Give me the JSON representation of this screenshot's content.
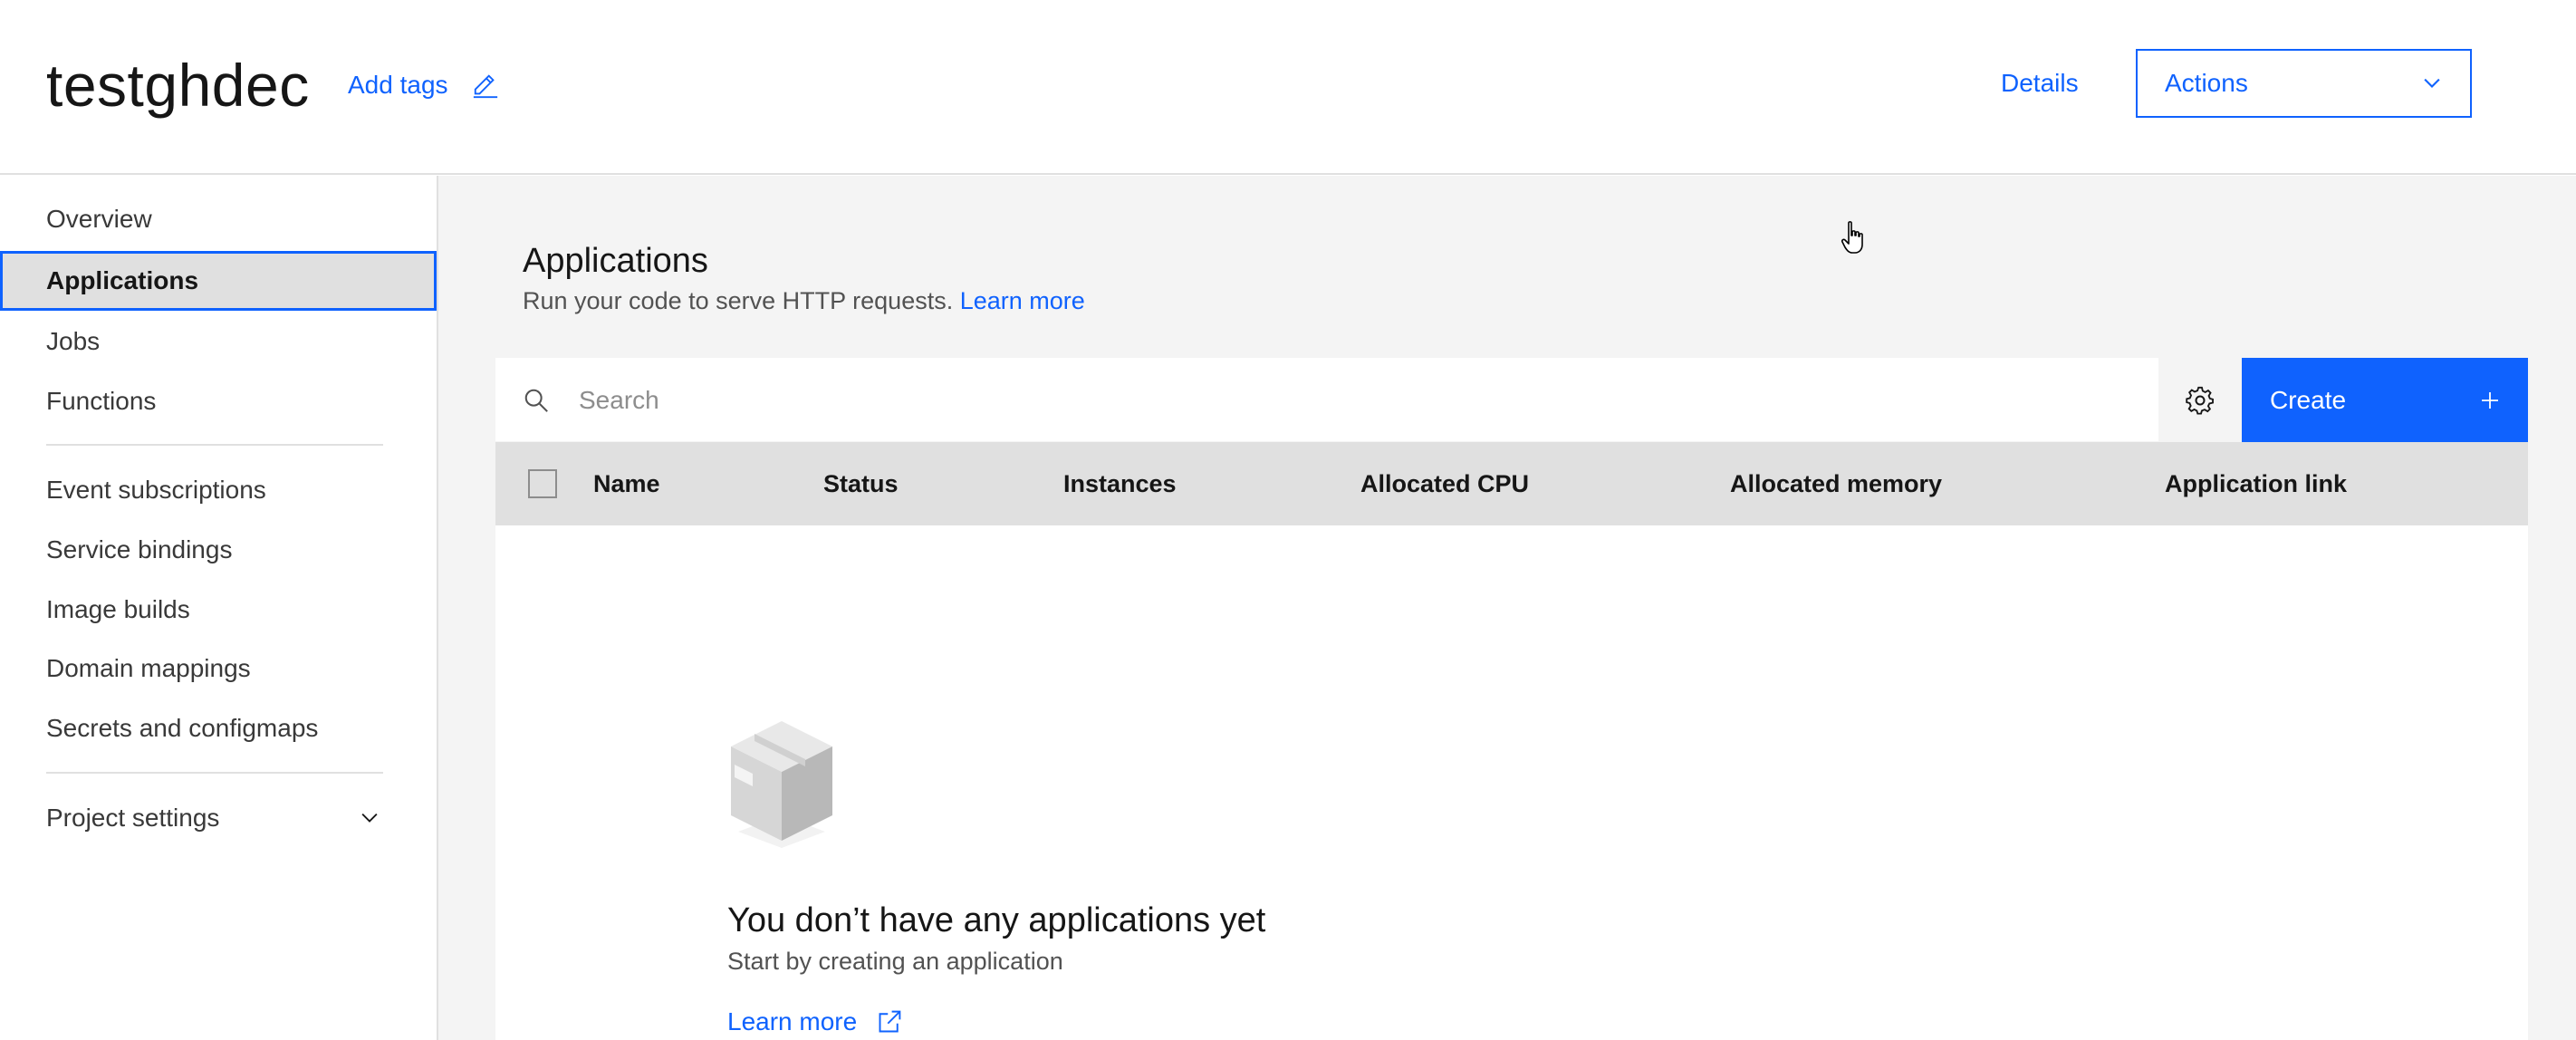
{
  "header": {
    "project_name": "testghdec",
    "add_tags_label": "Add tags",
    "details_label": "Details",
    "actions_label": "Actions"
  },
  "sidebar": {
    "items": [
      {
        "label": "Overview"
      },
      {
        "label": "Applications"
      },
      {
        "label": "Jobs"
      },
      {
        "label": "Functions"
      },
      {
        "label": "Event subscriptions"
      },
      {
        "label": "Service bindings"
      },
      {
        "label": "Image builds"
      },
      {
        "label": "Domain mappings"
      },
      {
        "label": "Secrets and configmaps"
      },
      {
        "label": "Project settings"
      }
    ],
    "active_item": "Applications"
  },
  "main": {
    "title": "Applications",
    "subtitle": "Run your code to serve HTTP requests.",
    "subtitle_link": "Learn more",
    "search": {
      "placeholder": "Search",
      "value": ""
    },
    "create_label": "Create",
    "table": {
      "columns": [
        "Name",
        "Status",
        "Instances",
        "Allocated CPU",
        "Allocated memory",
        "Application link"
      ],
      "rows": []
    },
    "empty_state": {
      "title": "You don’t have any applications yet",
      "subtitle": "Start by creating an application",
      "link_label": "Learn more"
    }
  },
  "icons": {
    "edit": "pencil-icon",
    "dropdown": "chevron-down-icon",
    "search": "search-icon",
    "settings": "gear-icon",
    "create": "plus-icon",
    "external": "launch-icon",
    "empty": "box-icon"
  },
  "colors": {
    "accent": "#0f62fe",
    "text_primary": "#161616",
    "text_secondary": "#525252",
    "page_bg": "#f4f4f4",
    "table_header_bg": "#e0e0e0"
  }
}
